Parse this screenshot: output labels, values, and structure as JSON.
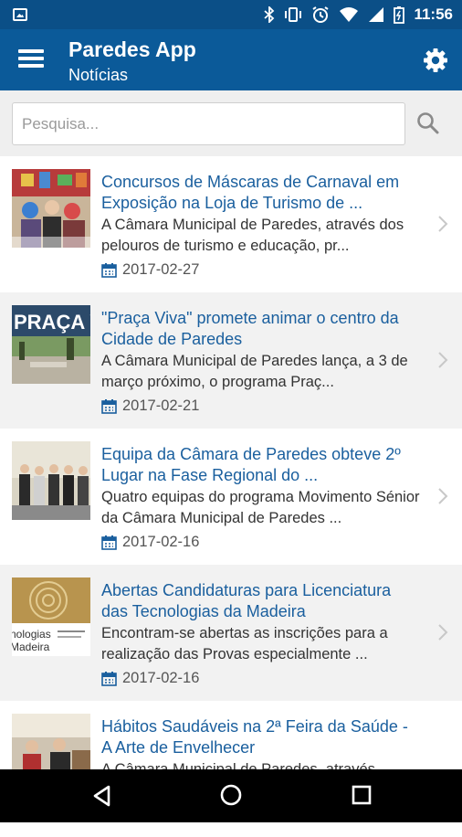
{
  "status_bar": {
    "time": "11:56"
  },
  "app_bar": {
    "title": "Paredes App",
    "subtitle": "Notícias"
  },
  "search": {
    "placeholder": "Pesquisa..."
  },
  "colors": {
    "primary": "#0b5a99",
    "status_bar": "#0b4f87",
    "link": "#1a5f9e"
  },
  "news": [
    {
      "title": "Concursos de Máscaras de Carnaval em Exposição na Loja de Turismo de ...",
      "summary": "A Câmara Municipal de Paredes, através dos pelouros de turismo e educação, pr...",
      "date": "2017-02-27"
    },
    {
      "title": "\"Praça Viva\" promete animar o centro da Cidade de Paredes",
      "summary": "A Câmara Municipal de Paredes lança, a 3 de março próximo, o programa Praç...",
      "date": "2017-02-21",
      "thumb_text": "PRAÇA V"
    },
    {
      "title": "Equipa da Câmara de Paredes obteve 2º Lugar na Fase Regional do ...",
      "summary": "Quatro equipas do programa Movimento Sénior da Câmara Municipal de Paredes ...",
      "date": "2017-02-16"
    },
    {
      "title": "Abertas Candidaturas para Licenciatura das Tecnologias da Madeira",
      "summary": "Encontram-se abertas as inscrições para a realização das Provas especialmente ...",
      "date": "2017-02-16",
      "thumb_text_1": "nologias",
      "thumb_text_2": "Madeira"
    },
    {
      "title": "Hábitos Saudáveis na 2ª Feira da Saúde - A Arte de Envelhecer",
      "summary": "A Câmara Municipal de Paredes, através",
      "date": ""
    }
  ]
}
